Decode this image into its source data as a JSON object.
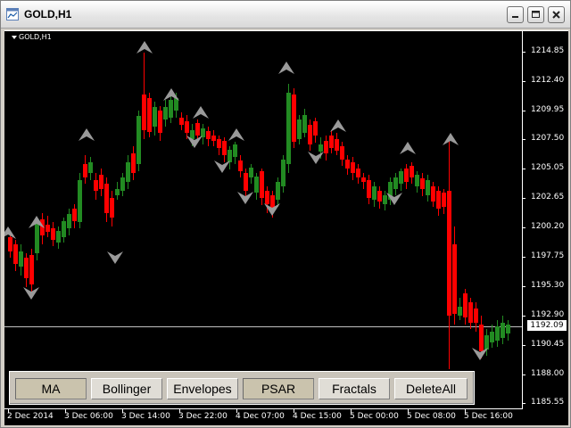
{
  "window": {
    "title": "GOLD,H1"
  },
  "chart": {
    "symbol_label": "GOLD,H1",
    "current_price": "1192.09",
    "price_labels": [
      "1214.85",
      "1212.40",
      "1209.95",
      "1207.50",
      "1205.05",
      "1202.65",
      "1200.20",
      "1197.75",
      "1195.30",
      "1192.90",
      "1190.45",
      "1188.00",
      "1185.55"
    ],
    "time_labels": [
      "2 Dec 2014",
      "3 Dec 06:00",
      "3 Dec 14:00",
      "3 Dec 22:00",
      "4 Dec 07:00",
      "4 Dec 15:00",
      "5 Dec 00:00",
      "5 Dec 08:00",
      "5 Dec 16:00"
    ],
    "colors": {
      "bull": "#228b22",
      "bear": "#ff0000",
      "fractal": "#9a9a9a",
      "background": "#000000",
      "price_line": "#c0c0c0"
    }
  },
  "buttons": [
    {
      "label": "MA",
      "active": true
    },
    {
      "label": "Bollinger",
      "active": false
    },
    {
      "label": "Envelopes",
      "active": false
    },
    {
      "label": "PSAR",
      "active": true
    },
    {
      "label": "Fractals",
      "active": false
    },
    {
      "label": "DeleteAll",
      "active": false
    }
  ]
}
